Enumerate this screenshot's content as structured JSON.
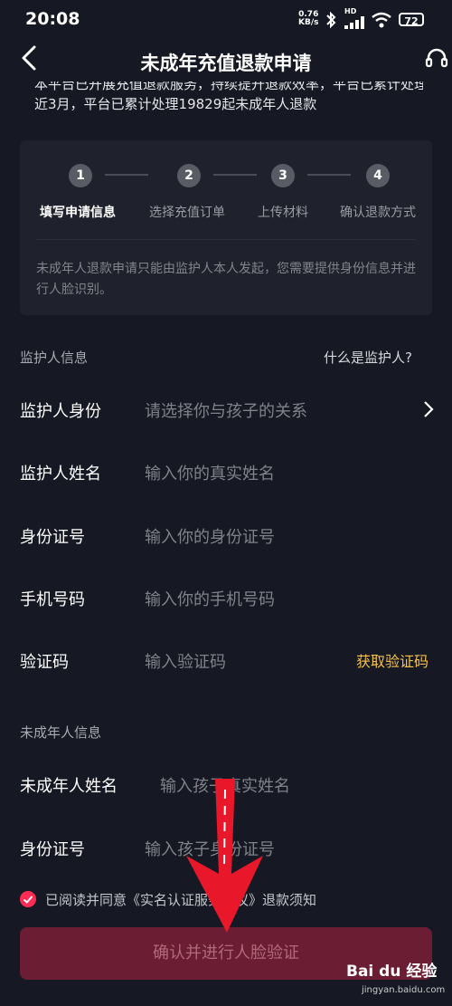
{
  "status_bar": {
    "time": "20:08",
    "net_speed": "0.76",
    "net_unit": "KB/s",
    "hd": "HD",
    "battery": "72"
  },
  "header": {
    "title": "未成年充值退款申请"
  },
  "notice": {
    "line1": "本平台已开展充值退款服务，持续提升退款效率，平台已累计处理未成年",
    "line2": "近3月，平台已累计处理19829起未成年人退款"
  },
  "steps": [
    {
      "num": "1",
      "label": "填写申请信息",
      "active": true
    },
    {
      "num": "2",
      "label": "选择充值订单",
      "active": false
    },
    {
      "num": "3",
      "label": "上传材料",
      "active": false
    },
    {
      "num": "4",
      "label": "确认退款方式",
      "active": false
    }
  ],
  "card_desc": "未成年人退款申请只能由监护人本人发起，您需要提供身份信息并进行人脸识别。",
  "guardian": {
    "section_title": "监护人信息",
    "what_is_link": "什么是监护人?",
    "identity_label": "监护人身份",
    "identity_placeholder": "请选择你与孩子的关系",
    "name_label": "监护人姓名",
    "name_placeholder": "输入你的真实姓名",
    "id_label": "身份证号",
    "id_placeholder": "输入你的身份证号",
    "phone_label": "手机号码",
    "phone_placeholder": "输入你的手机号码",
    "code_label": "验证码",
    "code_placeholder": "输入验证码",
    "get_code": "获取验证码"
  },
  "minor": {
    "section_title": "未成年人信息",
    "name_label": "未成年人姓名",
    "name_placeholder": "输入孩子真实姓名",
    "id_label": "身份证号",
    "id_placeholder": "输入孩子身份证号"
  },
  "agreement": {
    "text": "已阅读并同意《实名认证服务协议》退款须知",
    "checked": true
  },
  "submit_label": "确认并进行人脸验证",
  "watermark": {
    "logo": "Bai du 经验",
    "url": "jingyan.baidu.com"
  },
  "colors": {
    "background": "#161823",
    "accent": "#fe2c55",
    "link": "#f5c24b",
    "button_disabled": "#6b1d33"
  }
}
